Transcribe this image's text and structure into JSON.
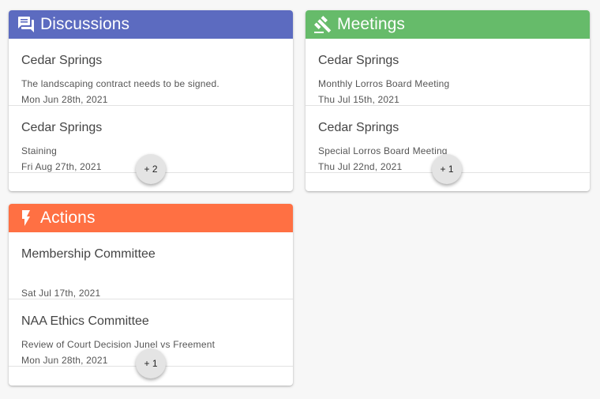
{
  "colors": {
    "discussions": "#5c6bc0",
    "meetings": "#66bb6a",
    "actions": "#ff7043"
  },
  "discussions": {
    "title": "Discussions",
    "icon": "forum-icon",
    "items": [
      {
        "title": "Cedar Springs",
        "desc": "The landscaping contract needs to be signed.",
        "date": "Mon Jun 28th, 2021"
      },
      {
        "title": "Cedar Springs",
        "desc": "Staining",
        "date": "Fri Aug 27th, 2021"
      }
    ],
    "more": "+ 2"
  },
  "meetings": {
    "title": "Meetings",
    "icon": "gavel-icon",
    "items": [
      {
        "title": "Cedar Springs",
        "desc": "Monthly Lorros Board Meeting",
        "date": "Thu Jul 15th, 2021"
      },
      {
        "title": "Cedar Springs",
        "desc": "Special Lorros Board Meeting",
        "date": "Thu Jul 22nd, 2021"
      }
    ],
    "more": "+ 1"
  },
  "actions": {
    "title": "Actions",
    "icon": "lightning-bolt-icon",
    "items": [
      {
        "title": "Membership Committee",
        "desc": "",
        "date": "Sat Jul 17th, 2021"
      },
      {
        "title": "NAA Ethics Committee",
        "desc": "Review of Court Decision Junel vs Freement",
        "date": "Mon Jun 28th, 2021"
      }
    ],
    "more": "+ 1"
  }
}
